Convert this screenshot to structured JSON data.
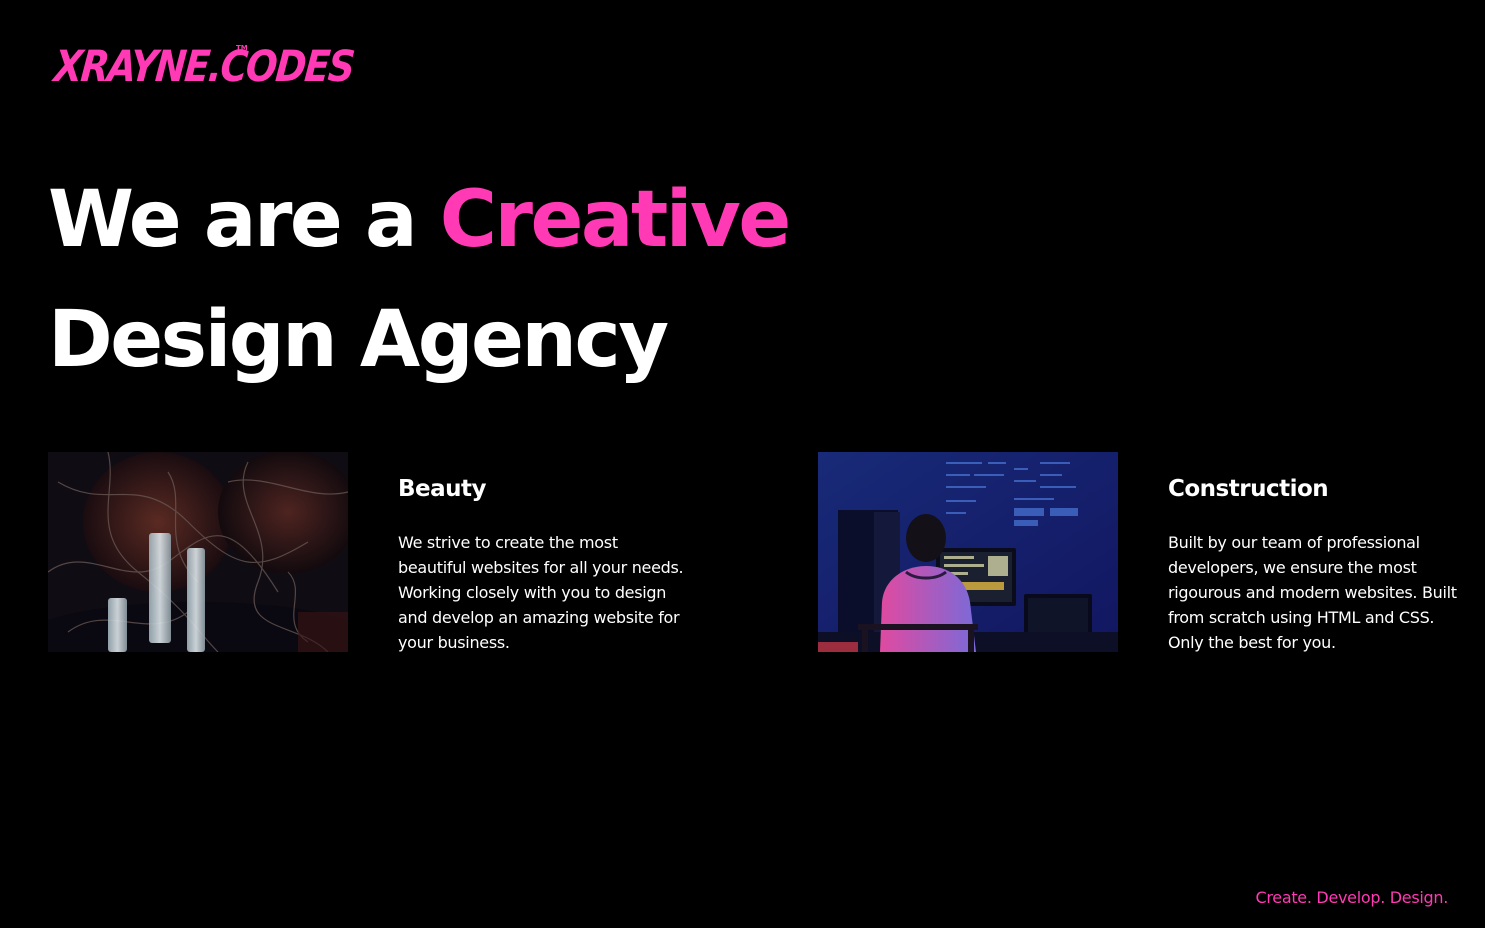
{
  "brand": {
    "logo_text": "XRAYNE.CODES",
    "trademark": "TM",
    "accent_color": "#ff3ab4",
    "background_color": "#000000"
  },
  "hero": {
    "line1_prefix": "We are a ",
    "line1_accent": "Creative",
    "line2": "Design Agency"
  },
  "cards": [
    {
      "image": "candles-photo",
      "title": "Beauty",
      "description": "We strive to create the most beautiful websites for all your needs. Working closely with you to design and develop an amazing website for your business."
    },
    {
      "image": "developer-at-computer-photo",
      "title": "Construction",
      "description": "Built by our team of professional developers, we ensure the most rigourous and modern websites. Built from scratch using HTML and CSS. Only the best for you."
    }
  ],
  "footer": {
    "tagline": "Create. Develop. Design."
  }
}
